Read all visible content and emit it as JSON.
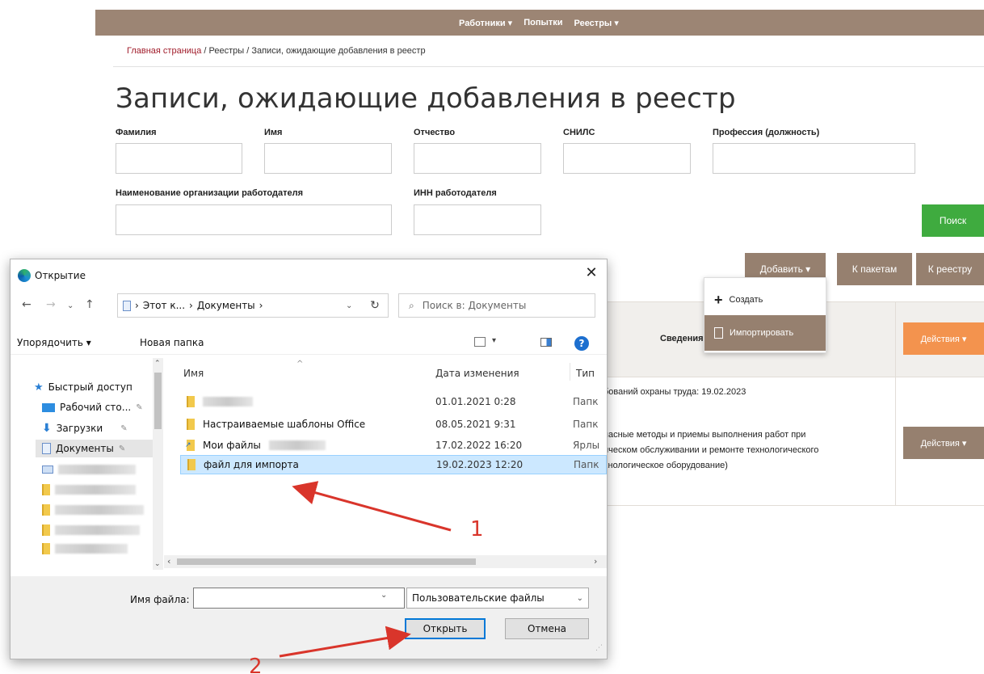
{
  "nav": {
    "workers": "Работники ▾",
    "attempts": "Попытки",
    "registries": "Реестры ▾"
  },
  "breadcrumb": {
    "home": "Главная страница",
    "sep1": " / ",
    "registries": "Реестры",
    "sep2": " / ",
    "current": "Записи, ожидающие добавления в реестр"
  },
  "page_title": "Записи, ожидающие добавления в реестр",
  "filters": {
    "last_name": "Фамилия",
    "first_name": "Имя",
    "patronymic": "Отчество",
    "snils": "СНИЛС",
    "profession": "Профессия (должность)",
    "employer_name": "Наименование организации работодателя",
    "employer_inn": "ИНН работодателя"
  },
  "buttons": {
    "search": "Поиск",
    "add": "Добавить ▾",
    "to_packages": "К пакетам",
    "to_registry": "К реестру"
  },
  "add_menu": {
    "create": "Создать",
    "import": "Импортировать"
  },
  "table": {
    "header": "Сведения",
    "actions_header": "Действия ▾",
    "row_actions": "Действия ▾",
    "row_lines": [
      "бований охраны труда: 19.02.2023",
      "пасные методы и приемы выполнения работ при",
      "ическом обслуживании и ремонте технологического",
      "хнологическое оборудование)"
    ]
  },
  "dialog": {
    "title": "Открытие",
    "address": {
      "this_pc": "Этот к...",
      "documents": "Документы"
    },
    "search_placeholder": "Поиск в: Документы",
    "organize": "Упорядочить ▾",
    "new_folder": "Новая папка",
    "nav_pane": [
      {
        "label": "Быстрый доступ",
        "icon": "star-icon"
      },
      {
        "label": "Рабочий сто...",
        "icon": "desktop-icon"
      },
      {
        "label": "Загрузки",
        "icon": "download-icon"
      },
      {
        "label": "Документы",
        "icon": "document-icon"
      }
    ],
    "columns": {
      "name": "Имя",
      "date": "Дата изменения",
      "type": "Тип"
    },
    "files": [
      {
        "name": "",
        "date": "01.01.2021 0:28",
        "type": "Папк"
      },
      {
        "name": "Настраиваемые шаблоны Office",
        "date": "08.05.2021 9:31",
        "type": "Папк"
      },
      {
        "name": "Мои файлы",
        "date": "17.02.2022 16:20",
        "type": "Ярлы"
      },
      {
        "name": "файл для импорта",
        "date": "19.02.2023 12:20",
        "type": "Папк"
      }
    ],
    "file_name_label": "Имя файла:",
    "file_name_value": "",
    "file_type": "Пользовательские файлы",
    "open": "Открыть",
    "cancel": "Отмена"
  },
  "annotations": {
    "step1": "1",
    "step2": "2"
  },
  "colors": {
    "nav_brown": "#9c8574",
    "button_brown": "#96806f",
    "search_green": "#3fab3f",
    "actions_orange": "#f3934e",
    "annotation_red": "#d9352b"
  }
}
